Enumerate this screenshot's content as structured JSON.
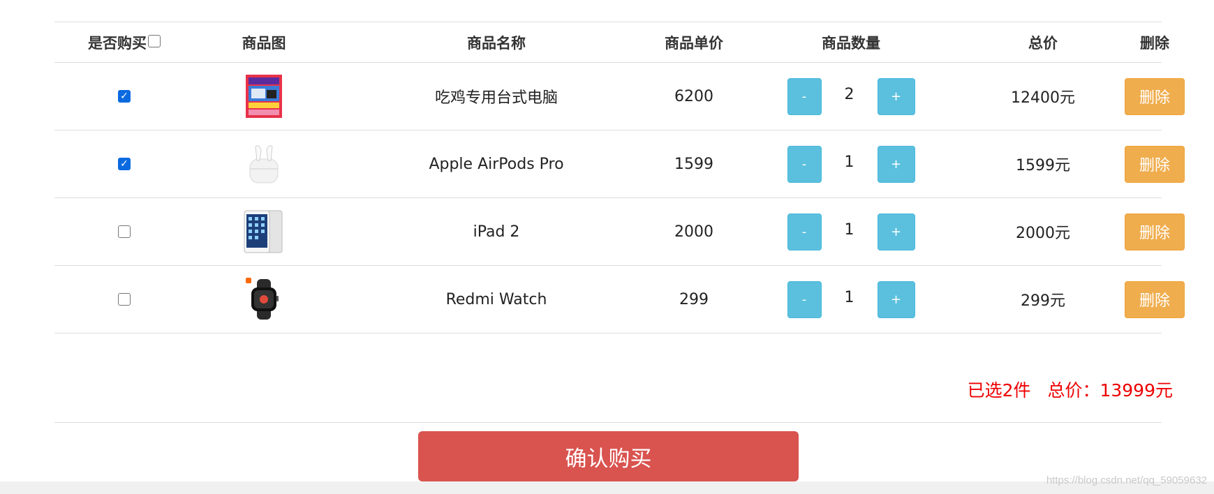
{
  "table": {
    "headers": {
      "buy": "是否购买",
      "image": "商品图",
      "name": "商品名称",
      "price": "商品单价",
      "quantity": "商品数量",
      "total": "总价",
      "delete": "删除"
    },
    "rows": [
      {
        "checked": true,
        "image_icon": "gaming-pc-poster-image",
        "name": "吃鸡专用台式电脑",
        "price": "6200",
        "minus": "-",
        "qty": "2",
        "plus": "+",
        "total": "12400元",
        "delete": "删除"
      },
      {
        "checked": true,
        "image_icon": "airpods-pro-image",
        "name": "Apple AirPods Pro",
        "price": "1599",
        "minus": "-",
        "qty": "1",
        "plus": "+",
        "total": "1599元",
        "delete": "删除"
      },
      {
        "checked": false,
        "image_icon": "ipad-image",
        "name": "iPad 2",
        "price": "2000",
        "minus": "-",
        "qty": "1",
        "plus": "+",
        "total": "2000元",
        "delete": "删除"
      },
      {
        "checked": false,
        "image_icon": "redmi-watch-image",
        "name": "Redmi Watch",
        "price": "299",
        "minus": "-",
        "qty": "1",
        "plus": "+",
        "total": "299元",
        "delete": "删除"
      }
    ]
  },
  "summary": {
    "selected": "已选2件",
    "total": "总价：13999元"
  },
  "confirm_button": "确认购买",
  "watermark": "https://blog.csdn.net/qq_59059632",
  "colors": {
    "qty_button": "#5bc0de",
    "delete_button": "#f0ad4e",
    "confirm_button": "#d9534f",
    "summary_text": "#e00000",
    "checkbox_checked": "#0b6ae0"
  }
}
